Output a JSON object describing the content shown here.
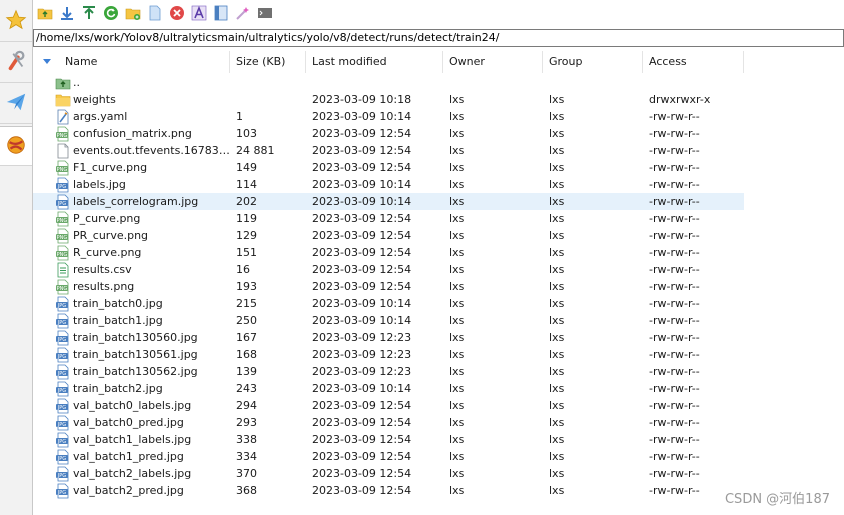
{
  "path": "/home/lxs/work/Yolov8/ultralyticsmain/ultralytics/yolo/v8/detect/runs/detect/train24/",
  "columns": {
    "name": "Name",
    "size": "Size (KB)",
    "modified": "Last modified",
    "owner": "Owner",
    "group": "Group",
    "access": "Access"
  },
  "toolbar_icons": [
    "parent-folder-icon",
    "download-icon",
    "upload-icon",
    "refresh-icon",
    "new-folder-icon",
    "new-file-icon",
    "delete-icon",
    "rename-icon",
    "properties-icon",
    "find-icon",
    "terminal-icon"
  ],
  "left_tabs": [
    "favorites-star-icon",
    "tools-icon",
    "send-plane-icon",
    "sftp-globe-icon"
  ],
  "files": [
    {
      "name": "..",
      "size": "",
      "modified": "",
      "owner": "",
      "group": "",
      "access": "",
      "type": "parent"
    },
    {
      "name": "weights",
      "size": "",
      "modified": "2023-03-09 10:18",
      "owner": "lxs",
      "group": "lxs",
      "access": "drwxrwxr-x",
      "type": "folder"
    },
    {
      "name": "args.yaml",
      "size": "1",
      "modified": "2023-03-09 10:14",
      "owner": "lxs",
      "group": "lxs",
      "access": "-rw-rw-r--",
      "type": "yaml"
    },
    {
      "name": "confusion_matrix.png",
      "size": "103",
      "modified": "2023-03-09 12:54",
      "owner": "lxs",
      "group": "lxs",
      "access": "-rw-rw-r--",
      "type": "png"
    },
    {
      "name": "events.out.tfevents.167832...",
      "size": "24 881",
      "modified": "2023-03-09 12:54",
      "owner": "lxs",
      "group": "lxs",
      "access": "-rw-rw-r--",
      "type": "file"
    },
    {
      "name": "F1_curve.png",
      "size": "149",
      "modified": "2023-03-09 12:54",
      "owner": "lxs",
      "group": "lxs",
      "access": "-rw-rw-r--",
      "type": "png"
    },
    {
      "name": "labels.jpg",
      "size": "114",
      "modified": "2023-03-09 10:14",
      "owner": "lxs",
      "group": "lxs",
      "access": "-rw-rw-r--",
      "type": "jpg"
    },
    {
      "name": "labels_correlogram.jpg",
      "size": "202",
      "modified": "2023-03-09 10:14",
      "owner": "lxs",
      "group": "lxs",
      "access": "-rw-rw-r--",
      "type": "jpg",
      "selected": true
    },
    {
      "name": "P_curve.png",
      "size": "119",
      "modified": "2023-03-09 12:54",
      "owner": "lxs",
      "group": "lxs",
      "access": "-rw-rw-r--",
      "type": "png"
    },
    {
      "name": "PR_curve.png",
      "size": "129",
      "modified": "2023-03-09 12:54",
      "owner": "lxs",
      "group": "lxs",
      "access": "-rw-rw-r--",
      "type": "png"
    },
    {
      "name": "R_curve.png",
      "size": "151",
      "modified": "2023-03-09 12:54",
      "owner": "lxs",
      "group": "lxs",
      "access": "-rw-rw-r--",
      "type": "png"
    },
    {
      "name": "results.csv",
      "size": "16",
      "modified": "2023-03-09 12:54",
      "owner": "lxs",
      "group": "lxs",
      "access": "-rw-rw-r--",
      "type": "csv"
    },
    {
      "name": "results.png",
      "size": "193",
      "modified": "2023-03-09 12:54",
      "owner": "lxs",
      "group": "lxs",
      "access": "-rw-rw-r--",
      "type": "png"
    },
    {
      "name": "train_batch0.jpg",
      "size": "215",
      "modified": "2023-03-09 10:14",
      "owner": "lxs",
      "group": "lxs",
      "access": "-rw-rw-r--",
      "type": "jpg"
    },
    {
      "name": "train_batch1.jpg",
      "size": "250",
      "modified": "2023-03-09 10:14",
      "owner": "lxs",
      "group": "lxs",
      "access": "-rw-rw-r--",
      "type": "jpg"
    },
    {
      "name": "train_batch130560.jpg",
      "size": "167",
      "modified": "2023-03-09 12:23",
      "owner": "lxs",
      "group": "lxs",
      "access": "-rw-rw-r--",
      "type": "jpg"
    },
    {
      "name": "train_batch130561.jpg",
      "size": "168",
      "modified": "2023-03-09 12:23",
      "owner": "lxs",
      "group": "lxs",
      "access": "-rw-rw-r--",
      "type": "jpg"
    },
    {
      "name": "train_batch130562.jpg",
      "size": "139",
      "modified": "2023-03-09 12:23",
      "owner": "lxs",
      "group": "lxs",
      "access": "-rw-rw-r--",
      "type": "jpg"
    },
    {
      "name": "train_batch2.jpg",
      "size": "243",
      "modified": "2023-03-09 10:14",
      "owner": "lxs",
      "group": "lxs",
      "access": "-rw-rw-r--",
      "type": "jpg"
    },
    {
      "name": "val_batch0_labels.jpg",
      "size": "294",
      "modified": "2023-03-09 12:54",
      "owner": "lxs",
      "group": "lxs",
      "access": "-rw-rw-r--",
      "type": "jpg"
    },
    {
      "name": "val_batch0_pred.jpg",
      "size": "293",
      "modified": "2023-03-09 12:54",
      "owner": "lxs",
      "group": "lxs",
      "access": "-rw-rw-r--",
      "type": "jpg"
    },
    {
      "name": "val_batch1_labels.jpg",
      "size": "338",
      "modified": "2023-03-09 12:54",
      "owner": "lxs",
      "group": "lxs",
      "access": "-rw-rw-r--",
      "type": "jpg"
    },
    {
      "name": "val_batch1_pred.jpg",
      "size": "334",
      "modified": "2023-03-09 12:54",
      "owner": "lxs",
      "group": "lxs",
      "access": "-rw-rw-r--",
      "type": "jpg"
    },
    {
      "name": "val_batch2_labels.jpg",
      "size": "370",
      "modified": "2023-03-09 12:54",
      "owner": "lxs",
      "group": "lxs",
      "access": "-rw-rw-r--",
      "type": "jpg"
    },
    {
      "name": "val_batch2_pred.jpg",
      "size": "368",
      "modified": "2023-03-09 12:54",
      "owner": "lxs",
      "group": "lxs",
      "access": "-rw-rw-r--",
      "type": "jpg"
    }
  ],
  "watermark": "CSDN @河伯187",
  "colors": {
    "selected_row": "#e5f1fb",
    "accent": "#3c7fd6"
  }
}
